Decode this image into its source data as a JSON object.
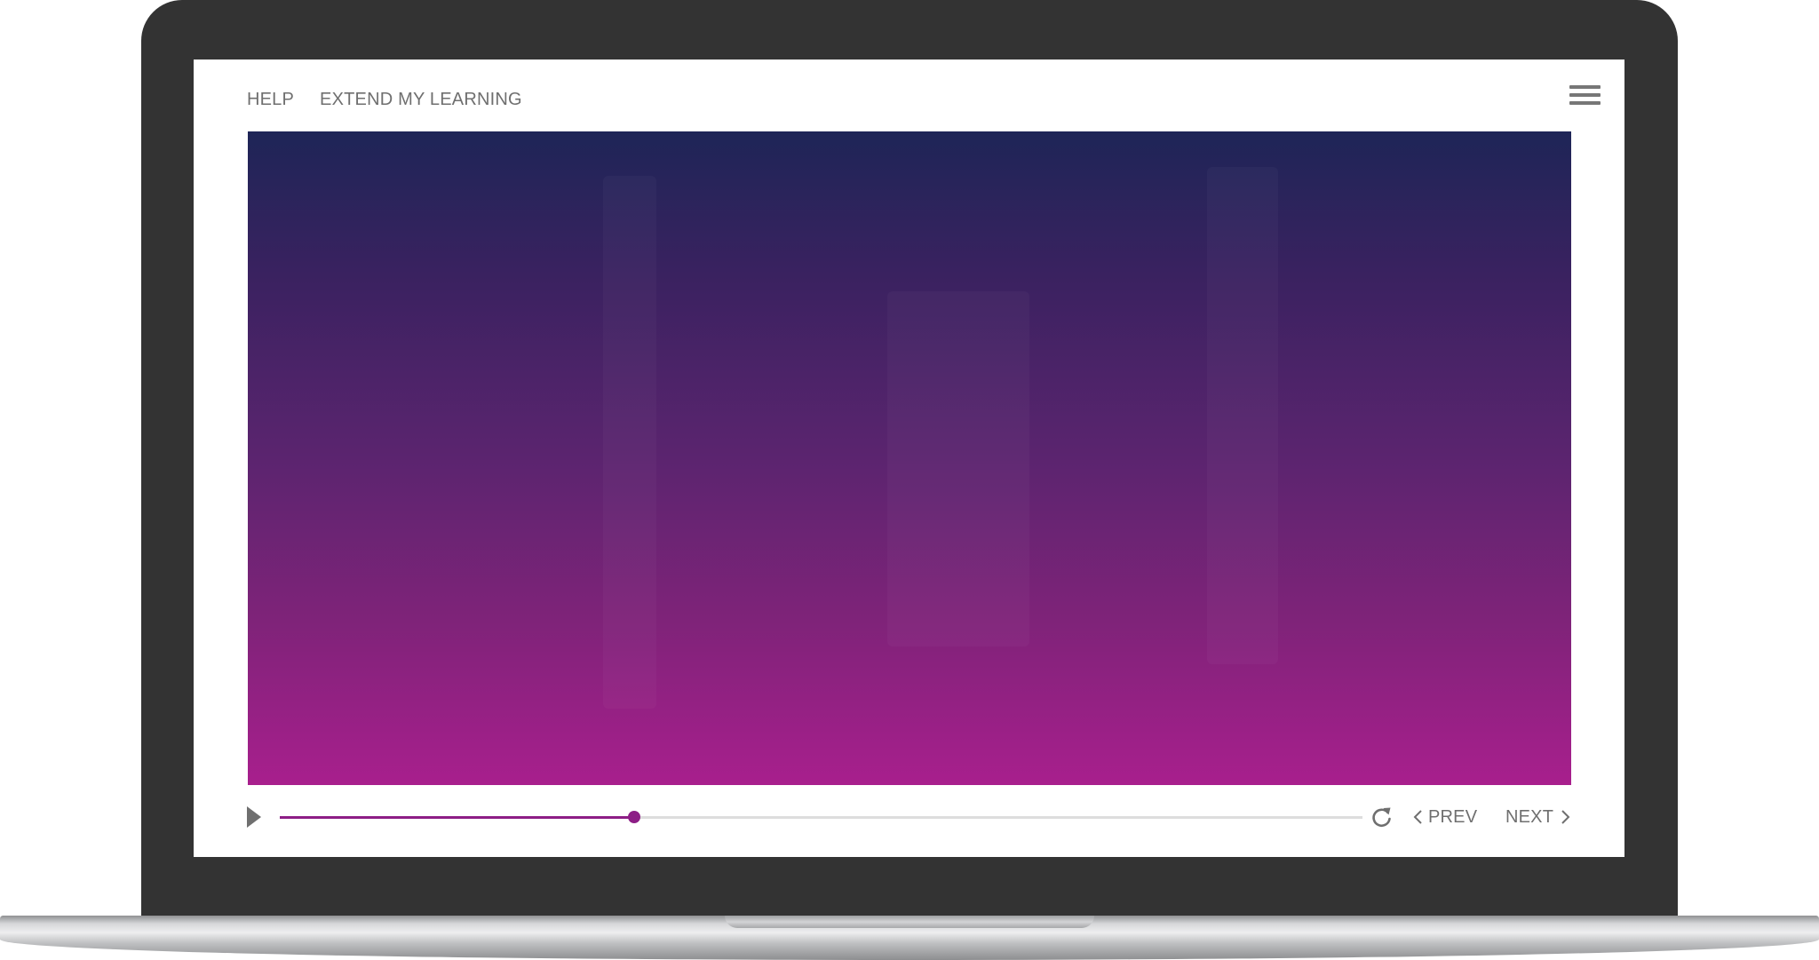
{
  "nav": {
    "help_label": "HELP",
    "extend_label": "EXTEND MY LEARNING",
    "menu_icon": "hamburger-menu-icon"
  },
  "media": {
    "gradient_top": "#1e2557",
    "gradient_bottom": "#a81f8d"
  },
  "player": {
    "progress": 0.327,
    "accent_color": "#8d1e86",
    "play_icon": "play-icon",
    "replay_icon": "replay-icon",
    "prev_label": "PREV",
    "next_label": "NEXT"
  }
}
